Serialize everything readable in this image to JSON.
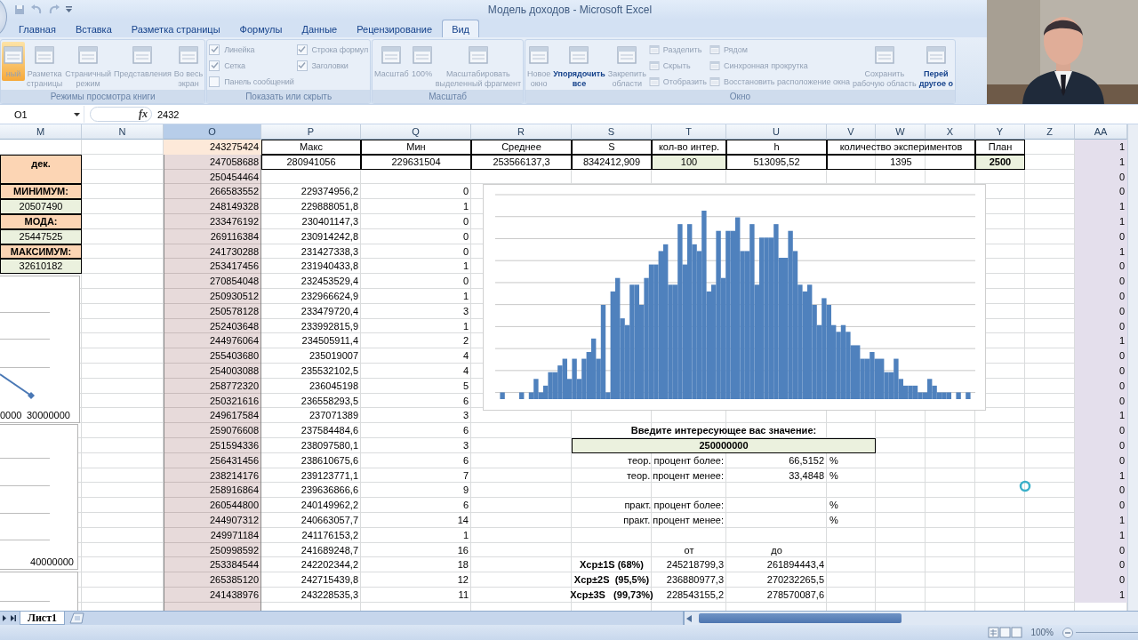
{
  "title_bar": {
    "title": "Модель доходов - Microsoft Excel"
  },
  "ribbon": {
    "tabs": [
      {
        "label": "Главная",
        "selected": false
      },
      {
        "label": "Вставка",
        "selected": false
      },
      {
        "label": "Разметка страницы",
        "selected": false
      },
      {
        "label": "Формулы",
        "selected": false
      },
      {
        "label": "Данные",
        "selected": false
      },
      {
        "label": "Рецензирование",
        "selected": false
      },
      {
        "label": "Вид",
        "selected": true
      }
    ],
    "groups": [
      {
        "label": "Режимы просмотра книги",
        "items": [
          {
            "kind": "large",
            "label": "ный",
            "selected": true,
            "disabled": true
          },
          {
            "kind": "large",
            "label": "Разметка\nстраницы",
            "selected": false,
            "disabled": true
          },
          {
            "kind": "large",
            "label": "Страничный\nрежим",
            "selected": false,
            "disabled": true
          },
          {
            "kind": "large",
            "label": "Представления",
            "selected": false,
            "disabled": true
          },
          {
            "kind": "large",
            "label": "Во весь\nэкран",
            "selected": false,
            "disabled": true
          }
        ]
      },
      {
        "label": "Показать или скрыть",
        "items": [
          {
            "kind": "stack",
            "items": [
              {
                "kind": "check",
                "label": "Линейка",
                "checked": true,
                "disabled": true
              },
              {
                "kind": "check",
                "label": "Сетка",
                "checked": true,
                "disabled": true
              },
              {
                "kind": "check",
                "label": "Панель сообщений",
                "checked": false,
                "disabled": true
              }
            ]
          },
          {
            "kind": "stack",
            "items": [
              {
                "kind": "check",
                "label": "Строка формул",
                "checked": true,
                "disabled": true
              },
              {
                "kind": "check",
                "label": "Заголовки",
                "checked": true,
                "disabled": true
              }
            ]
          }
        ]
      },
      {
        "label": "Масштаб",
        "items": [
          {
            "kind": "large",
            "label": "Масштаб",
            "disabled": true
          },
          {
            "kind": "large",
            "label": "100%",
            "disabled": true
          },
          {
            "kind": "large",
            "label": "Масштабировать\nвыделенный фрагмент",
            "disabled": true
          }
        ]
      },
      {
        "label": "Окно",
        "items": [
          {
            "kind": "large",
            "label": "Новое\nокно",
            "disabled": true
          },
          {
            "kind": "large",
            "label": "Упорядочить\nвсе",
            "disabled": false
          },
          {
            "kind": "dropdown",
            "label": "Закрепить\nобласти",
            "disabled": true
          },
          {
            "kind": "stack",
            "items": [
              {
                "kind": "small",
                "label": "Разделить",
                "disabled": true
              },
              {
                "kind": "small",
                "label": "Скрыть",
                "disabled": true
              },
              {
                "kind": "small",
                "label": "Отобразить",
                "disabled": true
              }
            ]
          },
          {
            "kind": "stack",
            "items": [
              {
                "kind": "small",
                "label": "Рядом",
                "disabled": true
              },
              {
                "kind": "small",
                "label": "Синхронная прокрутка",
                "disabled": true
              },
              {
                "kind": "small",
                "label": "Восстановить расположение окна",
                "disabled": true
              }
            ]
          },
          {
            "kind": "large",
            "label": "Сохранить\nрабочую область",
            "disabled": true
          },
          {
            "kind": "large",
            "label": "Перей\nдругое о",
            "disabled": false
          }
        ]
      }
    ]
  },
  "formula_bar": {
    "name_box": "O1",
    "function_button": "fx",
    "formula": "2432"
  },
  "sheet": {
    "columns": [
      {
        "label": "M",
        "selected": false
      },
      {
        "label": "N",
        "selected": false
      },
      {
        "label": "O",
        "selected": true
      },
      {
        "label": "P",
        "selected": false
      },
      {
        "label": "Q",
        "selected": false
      },
      {
        "label": "R",
        "selected": false
      },
      {
        "label": "S",
        "selected": false
      },
      {
        "label": "T",
        "selected": false
      },
      {
        "label": "U",
        "selected": false
      },
      {
        "label": "V",
        "selected": false
      },
      {
        "label": "W",
        "selected": false
      },
      {
        "label": "X",
        "selected": false
      },
      {
        "label": "Y",
        "selected": false
      },
      {
        "label": "Z",
        "selected": false
      },
      {
        "label": "AA",
        "selected": false
      }
    ],
    "rows": [
      {
        "o": {
          "text": "243275424",
          "kind": "active"
        },
        "p": {
          "text": "Макс",
          "kind": "box"
        },
        "q": {
          "text": "Мин",
          "kind": "box"
        },
        "r": {
          "text": "Среднее",
          "kind": "box"
        },
        "s": {
          "text": "S",
          "kind": "box"
        },
        "t": {
          "text": "кол-во интер.",
          "kind": "box"
        },
        "u": {
          "text": "h",
          "kind": "box"
        },
        "v": {
          "text": "количество экспериментов",
          "kind": "wide_box"
        },
        "y": {
          "text": "План",
          "kind": "box"
        },
        "aa": {
          "text": "1",
          "kind": "flag"
        }
      },
      {
        "m": {
          "text": "дек.",
          "kind": "m_head"
        },
        "o": {
          "text": "247058688",
          "kind": "num"
        },
        "p": {
          "text": "280941056",
          "kind": "box"
        },
        "q": {
          "text": "229631504",
          "kind": "box"
        },
        "r": {
          "text": "253566137,3",
          "kind": "box"
        },
        "s": {
          "text": "8342412,909",
          "kind": "box"
        },
        "t": {
          "text": "100",
          "kind": "input"
        },
        "u": {
          "text": "513095,52",
          "kind": "box"
        },
        "v": {
          "text": "1395",
          "kind": "wide_box"
        },
        "y": {
          "text": "2500",
          "kind": "input_bold"
        },
        "aa": {
          "text": "1",
          "kind": "flag"
        }
      },
      {
        "o": {
          "text": "250454464",
          "kind": "num"
        },
        "aa": {
          "text": "0",
          "kind": "flag"
        }
      },
      {
        "m": {
          "text": "МИНИМУМ:",
          "kind": "m_label"
        },
        "o": {
          "text": "266583552",
          "kind": "num"
        },
        "p": {
          "text": "229374956,2",
          "kind": "num"
        },
        "q": {
          "text": "0",
          "kind": "num"
        },
        "aa": {
          "text": "0",
          "kind": "flag"
        }
      },
      {
        "m": {
          "text": "20507490",
          "kind": "m_value"
        },
        "o": {
          "text": "248149328",
          "kind": "num"
        },
        "p": {
          "text": "229888051,8",
          "kind": "num"
        },
        "q": {
          "text": "1",
          "kind": "num"
        },
        "aa": {
          "text": "1",
          "kind": "flag"
        }
      },
      {
        "m": {
          "text": "МОДА:",
          "kind": "m_label"
        },
        "o": {
          "text": "233476192",
          "kind": "num"
        },
        "p": {
          "text": "230401147,3",
          "kind": "num"
        },
        "q": {
          "text": "0",
          "kind": "num"
        },
        "aa": {
          "text": "1",
          "kind": "flag"
        }
      },
      {
        "m": {
          "text": "25447525",
          "kind": "m_value"
        },
        "o": {
          "text": "269116384",
          "kind": "num"
        },
        "p": {
          "text": "230914242,8",
          "kind": "num"
        },
        "q": {
          "text": "0",
          "kind": "num"
        },
        "aa": {
          "text": "0",
          "kind": "flag"
        }
      },
      {
        "m": {
          "text": "МАКСИМУМ:",
          "kind": "m_label"
        },
        "o": {
          "text": "241730288",
          "kind": "num"
        },
        "p": {
          "text": "231427338,3",
          "kind": "num"
        },
        "q": {
          "text": "0",
          "kind": "num"
        },
        "aa": {
          "text": "1",
          "kind": "flag"
        }
      },
      {
        "m": {
          "text": "32610182",
          "kind": "m_value"
        },
        "o": {
          "text": "253417456",
          "kind": "num"
        },
        "p": {
          "text": "231940433,8",
          "kind": "num"
        },
        "q": {
          "text": "1",
          "kind": "num"
        },
        "aa": {
          "text": "0",
          "kind": "flag"
        }
      },
      {
        "o": {
          "text": "270854048",
          "kind": "num"
        },
        "p": {
          "text": "232453529,4",
          "kind": "num"
        },
        "q": {
          "text": "0",
          "kind": "num"
        },
        "aa": {
          "text": "0",
          "kind": "flag"
        }
      },
      {
        "o": {
          "text": "250930512",
          "kind": "num"
        },
        "p": {
          "text": "232966624,9",
          "kind": "num"
        },
        "q": {
          "text": "1",
          "kind": "num"
        },
        "aa": {
          "text": "0",
          "kind": "flag"
        }
      },
      {
        "o": {
          "text": "250578128",
          "kind": "num"
        },
        "p": {
          "text": "233479720,4",
          "kind": "num"
        },
        "q": {
          "text": "3",
          "kind": "num"
        },
        "aa": {
          "text": "0",
          "kind": "flag"
        }
      },
      {
        "o": {
          "text": "252403648",
          "kind": "num"
        },
        "p": {
          "text": "233992815,9",
          "kind": "num"
        },
        "q": {
          "text": "1",
          "kind": "num"
        },
        "aa": {
          "text": "0",
          "kind": "flag"
        }
      },
      {
        "o": {
          "text": "244976064",
          "kind": "num"
        },
        "p": {
          "text": "234505911,4",
          "kind": "num"
        },
        "q": {
          "text": "2",
          "kind": "num"
        },
        "aa": {
          "text": "1",
          "kind": "flag"
        }
      },
      {
        "o": {
          "text": "255403680",
          "kind": "num"
        },
        "p": {
          "text": "235019007",
          "kind": "num"
        },
        "q": {
          "text": "4",
          "kind": "num"
        },
        "aa": {
          "text": "0",
          "kind": "flag"
        }
      },
      {
        "o": {
          "text": "254003088",
          "kind": "num"
        },
        "p": {
          "text": "235532102,5",
          "kind": "num"
        },
        "q": {
          "text": "4",
          "kind": "num"
        },
        "aa": {
          "text": "0",
          "kind": "flag"
        }
      },
      {
        "o": {
          "text": "258772320",
          "kind": "num"
        },
        "p": {
          "text": "236045198",
          "kind": "num"
        },
        "q": {
          "text": "5",
          "kind": "num"
        },
        "aa": {
          "text": "0",
          "kind": "flag"
        }
      },
      {
        "o": {
          "text": "250321616",
          "kind": "num"
        },
        "p": {
          "text": "236558293,5",
          "kind": "num"
        },
        "q": {
          "text": "6",
          "kind": "num"
        },
        "aa": {
          "text": "0",
          "kind": "flag"
        }
      },
      {
        "o": {
          "text": "249617584",
          "kind": "num"
        },
        "p": {
          "text": "237071389",
          "kind": "num"
        },
        "q": {
          "text": "3",
          "kind": "num"
        },
        "aa": {
          "text": "1",
          "kind": "flag"
        }
      },
      {
        "o": {
          "text": "259076608",
          "kind": "num"
        },
        "p": {
          "text": "237584484,6",
          "kind": "num"
        },
        "q": {
          "text": "6",
          "kind": "num"
        },
        "s": {
          "text": "Введите интересующее вас значение:",
          "kind": "prompt"
        },
        "aa": {
          "text": "0",
          "kind": "flag"
        }
      },
      {
        "o": {
          "text": "251594336",
          "kind": "num"
        },
        "p": {
          "text": "238097580,1",
          "kind": "num"
        },
        "q": {
          "text": "3",
          "kind": "num"
        },
        "s": {
          "text": "250000000",
          "kind": "entry"
        },
        "aa": {
          "text": "0",
          "kind": "flag"
        }
      },
      {
        "o": {
          "text": "256431456",
          "kind": "num"
        },
        "p": {
          "text": "238610675,6",
          "kind": "num"
        },
        "q": {
          "text": "6",
          "kind": "num"
        },
        "s": {
          "text": "теор. процент более:",
          "kind": "note"
        },
        "u": {
          "text": "66,5152",
          "kind": "num"
        },
        "v": {
          "text": "%",
          "kind": "pct"
        },
        "aa": {
          "text": "0",
          "kind": "flag"
        }
      },
      {
        "o": {
          "text": "238214176",
          "kind": "num"
        },
        "p": {
          "text": "239123771,1",
          "kind": "num"
        },
        "q": {
          "text": "7",
          "kind": "num"
        },
        "s": {
          "text": "теор. процент менее:",
          "kind": "note"
        },
        "u": {
          "text": "33,4848",
          "kind": "num"
        },
        "v": {
          "text": "%",
          "kind": "pct"
        },
        "aa": {
          "text": "1",
          "kind": "flag"
        }
      },
      {
        "o": {
          "text": "258916864",
          "kind": "num"
        },
        "p": {
          "text": "239636866,6",
          "kind": "num"
        },
        "q": {
          "text": "9",
          "kind": "num"
        },
        "aa": {
          "text": "0",
          "kind": "flag"
        }
      },
      {
        "o": {
          "text": "260544800",
          "kind": "num"
        },
        "p": {
          "text": "240149962,2",
          "kind": "num"
        },
        "q": {
          "text": "6",
          "kind": "num"
        },
        "s": {
          "text": "практ. процент более:",
          "kind": "note"
        },
        "v": {
          "text": "%",
          "kind": "pct"
        },
        "aa": {
          "text": "0",
          "kind": "flag"
        }
      },
      {
        "o": {
          "text": "244907312",
          "kind": "num"
        },
        "p": {
          "text": "240663057,7",
          "kind": "num"
        },
        "q": {
          "text": "14",
          "kind": "num"
        },
        "s": {
          "text": "практ. процент менее:",
          "kind": "note"
        },
        "v": {
          "text": "%",
          "kind": "pct"
        },
        "aa": {
          "text": "1",
          "kind": "flag"
        }
      },
      {
        "o": {
          "text": "249971184",
          "kind": "num"
        },
        "p": {
          "text": "241176153,2",
          "kind": "num"
        },
        "q": {
          "text": "1",
          "kind": "num"
        },
        "aa": {
          "text": "1",
          "kind": "flag"
        }
      },
      {
        "o": {
          "text": "250998592",
          "kind": "num"
        },
        "p": {
          "text": "241689248,7",
          "kind": "num"
        },
        "q": {
          "text": "16",
          "kind": "num"
        },
        "t": {
          "text": "от",
          "kind": "center"
        },
        "u": {
          "text": "до",
          "kind": "center"
        },
        "aa": {
          "text": "0",
          "kind": "flag"
        }
      },
      {
        "o": {
          "text": "253384544",
          "kind": "num"
        },
        "p": {
          "text": "242202344,2",
          "kind": "num"
        },
        "q": {
          "text": "18",
          "kind": "num"
        },
        "s": {
          "text": "Xcp±1S (68%)",
          "kind": "range"
        },
        "t": {
          "text": "245218799,3",
          "kind": "num"
        },
        "u": {
          "text": "261894443,4",
          "kind": "num"
        },
        "aa": {
          "text": "0",
          "kind": "flag"
        }
      },
      {
        "o": {
          "text": "265385120",
          "kind": "num"
        },
        "p": {
          "text": "242715439,8",
          "kind": "num"
        },
        "q": {
          "text": "12",
          "kind": "num"
        },
        "s": {
          "text": "Xcp±2S  (95,5%)",
          "kind": "range"
        },
        "t": {
          "text": "236880977,3",
          "kind": "num"
        },
        "u": {
          "text": "270232265,5",
          "kind": "num"
        },
        "aa": {
          "text": "0",
          "kind": "flag"
        }
      },
      {
        "o": {
          "text": "241438976",
          "kind": "num"
        },
        "p": {
          "text": "243228535,3",
          "kind": "num"
        },
        "q": {
          "text": "11",
          "kind": "num"
        },
        "s": {
          "text": "Xcp±3S   (99,73%)",
          "kind": "range"
        },
        "t": {
          "text": "228543155,2",
          "kind": "num"
        },
        "u": {
          "text": "278570087,6",
          "kind": "num"
        },
        "aa": {
          "text": "1",
          "kind": "flag"
        }
      }
    ],
    "side_charts": [
      {
        "kind": "line",
        "labels": [
          "0000",
          "30000000"
        ]
      },
      {
        "kind": "grid",
        "labels": [
          "40000000"
        ]
      },
      {
        "kind": "grid"
      }
    ]
  },
  "sheet_tabs": [
    {
      "label": "Лист1",
      "selected": true
    }
  ],
  "status_bar": {
    "zoom": "100%"
  }
}
